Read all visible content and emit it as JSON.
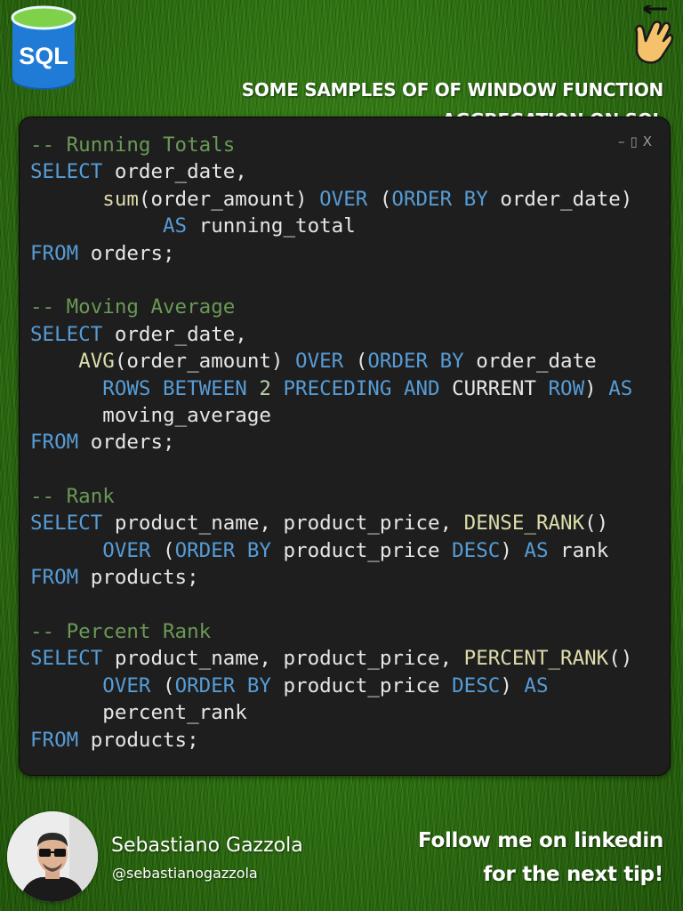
{
  "logo": {
    "text": "SQL",
    "icon": "database-cylinder-icon",
    "color": "#1f7bd6"
  },
  "hand_icon": {
    "icon": "pointing-hand-swipe-icon",
    "color": "#f5c26b"
  },
  "heading": {
    "line1": "SOME SAMPLES OF OF WINDOW FUNCTION",
    "line2": "AGGREGATION ON SQL"
  },
  "window_controls": {
    "minimize": "–",
    "maximize": "▯",
    "close": "X"
  },
  "code_lines": [
    [
      {
        "t": "-- Running Totals",
        "c": "cm"
      }
    ],
    [
      {
        "t": "SELECT",
        "c": "kw"
      },
      {
        "t": " order_date,",
        "c": ""
      }
    ],
    [
      {
        "t": "      ",
        "c": ""
      },
      {
        "t": "sum",
        "c": "fn"
      },
      {
        "t": "(order_amount) ",
        "c": ""
      },
      {
        "t": "OVER",
        "c": "kw"
      },
      {
        "t": " (",
        "c": ""
      },
      {
        "t": "ORDER BY",
        "c": "kw"
      },
      {
        "t": " order_date)",
        "c": ""
      }
    ],
    [
      {
        "t": "           ",
        "c": ""
      },
      {
        "t": "AS",
        "c": "kw"
      },
      {
        "t": " running_total",
        "c": ""
      }
    ],
    [
      {
        "t": "FROM",
        "c": "kw"
      },
      {
        "t": " orders;",
        "c": ""
      }
    ],
    [
      {
        "t": "",
        "c": ""
      }
    ],
    [
      {
        "t": "-- Moving Average",
        "c": "cm"
      }
    ],
    [
      {
        "t": "SELECT",
        "c": "kw"
      },
      {
        "t": " order_date,",
        "c": ""
      }
    ],
    [
      {
        "t": "    ",
        "c": ""
      },
      {
        "t": "AVG",
        "c": "fn"
      },
      {
        "t": "(order_amount) ",
        "c": ""
      },
      {
        "t": "OVER",
        "c": "kw"
      },
      {
        "t": " (",
        "c": ""
      },
      {
        "t": "ORDER BY",
        "c": "kw"
      },
      {
        "t": " order_date",
        "c": ""
      }
    ],
    [
      {
        "t": "      ",
        "c": ""
      },
      {
        "t": "ROWS BETWEEN",
        "c": "kw"
      },
      {
        "t": " ",
        "c": ""
      },
      {
        "t": "2",
        "c": "num"
      },
      {
        "t": " ",
        "c": ""
      },
      {
        "t": "PRECEDING AND",
        "c": "kw"
      },
      {
        "t": " CURRENT ",
        "c": ""
      },
      {
        "t": "ROW",
        "c": "kw"
      },
      {
        "t": ") ",
        "c": ""
      },
      {
        "t": "AS",
        "c": "kw"
      }
    ],
    [
      {
        "t": "      moving_average",
        "c": ""
      }
    ],
    [
      {
        "t": "FROM",
        "c": "kw"
      },
      {
        "t": " orders;",
        "c": ""
      }
    ],
    [
      {
        "t": "",
        "c": ""
      }
    ],
    [
      {
        "t": "-- Rank",
        "c": "cm"
      }
    ],
    [
      {
        "t": "SELECT",
        "c": "kw"
      },
      {
        "t": " product_name, product_price, ",
        "c": ""
      },
      {
        "t": "DENSE_RANK",
        "c": "fn"
      },
      {
        "t": "()",
        "c": ""
      }
    ],
    [
      {
        "t": "      ",
        "c": ""
      },
      {
        "t": "OVER",
        "c": "kw"
      },
      {
        "t": " (",
        "c": ""
      },
      {
        "t": "ORDER BY",
        "c": "kw"
      },
      {
        "t": " product_price ",
        "c": ""
      },
      {
        "t": "DESC",
        "c": "kw"
      },
      {
        "t": ") ",
        "c": ""
      },
      {
        "t": "AS",
        "c": "kw"
      },
      {
        "t": " rank",
        "c": ""
      }
    ],
    [
      {
        "t": "FROM",
        "c": "kw"
      },
      {
        "t": " products;",
        "c": ""
      }
    ],
    [
      {
        "t": "",
        "c": ""
      }
    ],
    [
      {
        "t": "-- Percent Rank",
        "c": "cm"
      }
    ],
    [
      {
        "t": "SELECT",
        "c": "kw"
      },
      {
        "t": " product_name, product_price, ",
        "c": ""
      },
      {
        "t": "PERCENT_RANK",
        "c": "fn"
      },
      {
        "t": "()",
        "c": ""
      }
    ],
    [
      {
        "t": "      ",
        "c": ""
      },
      {
        "t": "OVER",
        "c": "kw"
      },
      {
        "t": " (",
        "c": ""
      },
      {
        "t": "ORDER BY",
        "c": "kw"
      },
      {
        "t": " product_price ",
        "c": ""
      },
      {
        "t": "DESC",
        "c": "kw"
      },
      {
        "t": ") ",
        "c": ""
      },
      {
        "t": "AS",
        "c": "kw"
      }
    ],
    [
      {
        "t": "      percent_rank",
        "c": ""
      }
    ],
    [
      {
        "t": "FROM",
        "c": "kw"
      },
      {
        "t": " products;",
        "c": ""
      }
    ]
  ],
  "author": {
    "name": "Sebastiano Gazzola",
    "handle": "@sebastianogazzola",
    "avatar_icon": "profile-photo"
  },
  "cta": {
    "line1": "Follow me on linkedin",
    "line2": "for the next tip!"
  }
}
